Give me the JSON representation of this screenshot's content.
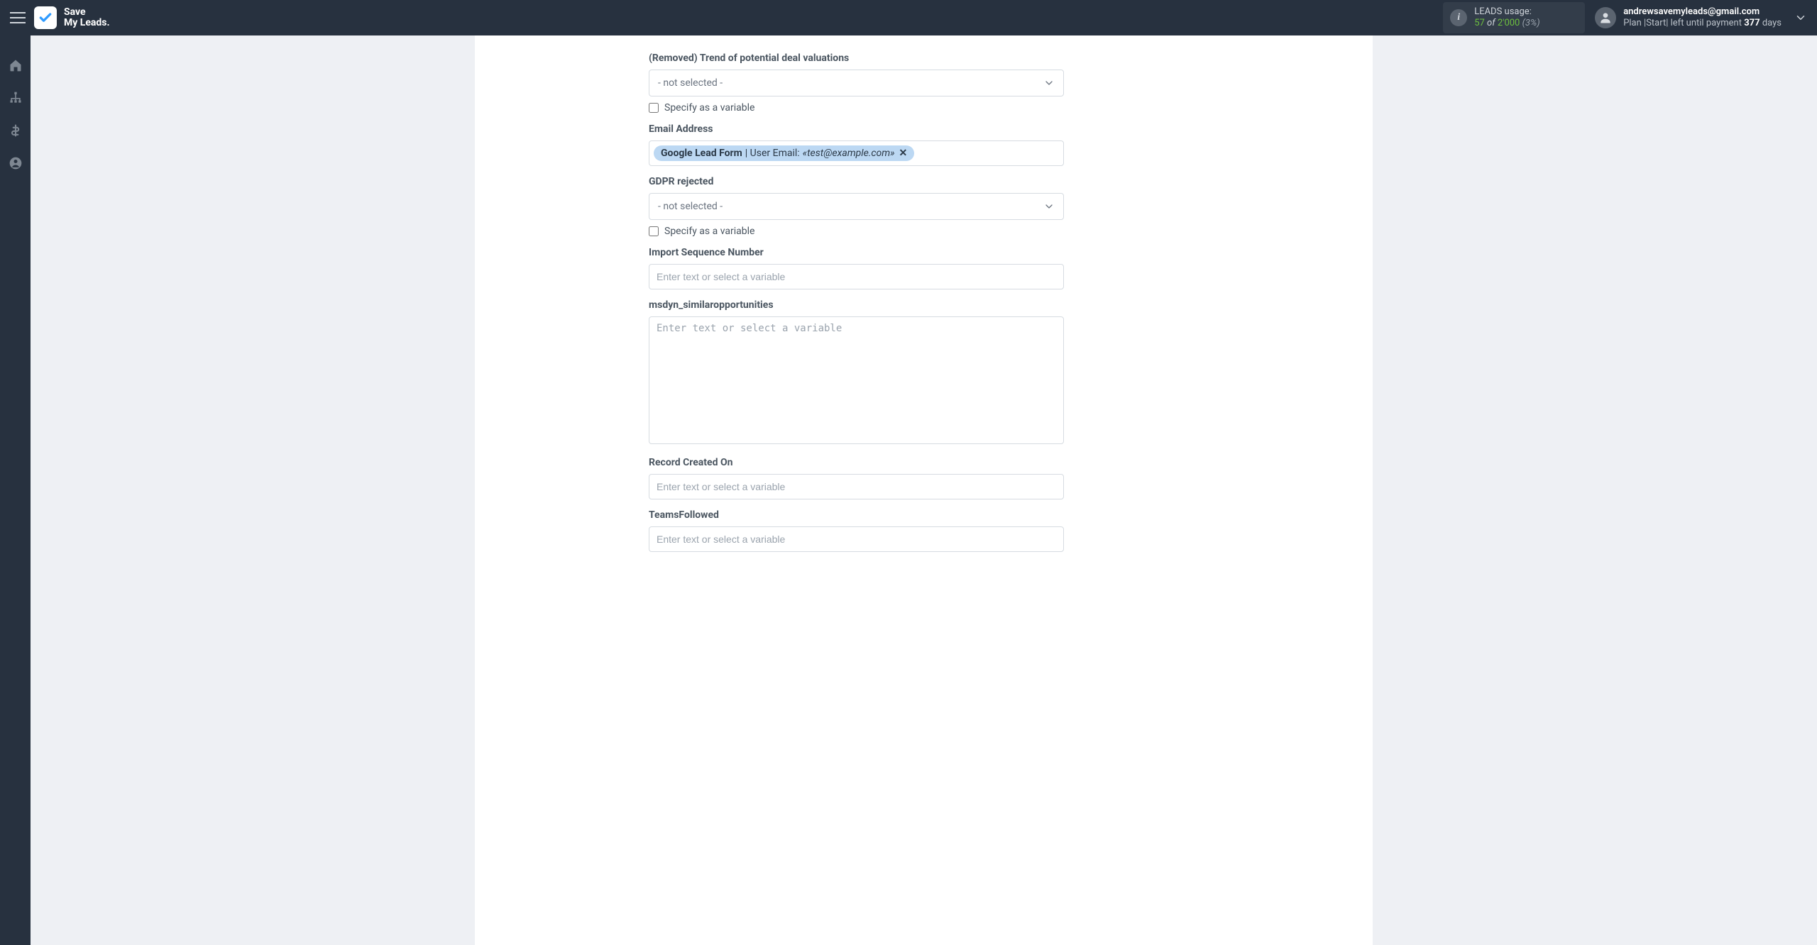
{
  "header": {
    "logo_line1": "Save",
    "logo_line2": "My Leads.",
    "usage_label": "LEADS usage:",
    "usage_current": "57",
    "usage_of": "of",
    "usage_limit": "2'000",
    "usage_pct": "(3%)",
    "account_email": "andrewsavemyleads@gmail.com",
    "plan_prefix": "Plan |Start| left until payment ",
    "plan_days": "377",
    "plan_suffix": " days"
  },
  "form": {
    "f0": {
      "label": "(Removed) Trend of potential deal valuations",
      "select_placeholder": "- not selected -",
      "var_label": "Specify as a variable"
    },
    "f1": {
      "label": "Email Address",
      "token_source": "Google Lead Form",
      "token_sep": " | User Email: ",
      "token_value": "«test@example.com»"
    },
    "f2": {
      "label": "GDPR rejected",
      "select_placeholder": "- not selected -",
      "var_label": "Specify as a variable"
    },
    "f3": {
      "label": "Import Sequence Number",
      "placeholder": "Enter text or select a variable"
    },
    "f4": {
      "label": "msdyn_similaropportunities",
      "placeholder": "Enter text or select a variable"
    },
    "f5": {
      "label": "Record Created On",
      "placeholder": "Enter text or select a variable"
    },
    "f6": {
      "label": "TeamsFollowed",
      "placeholder": "Enter text or select a variable"
    }
  }
}
